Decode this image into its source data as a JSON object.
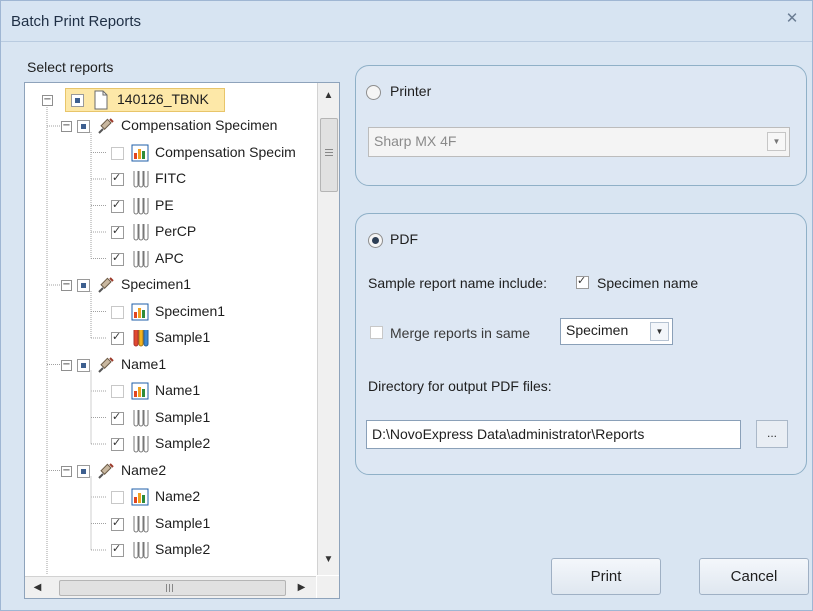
{
  "window": {
    "title": "Batch Print Reports",
    "close_glyph": "✕"
  },
  "select_reports_label": "Select reports",
  "tree": {
    "root": {
      "label": "140126_TBNK",
      "icon": "document-icon"
    },
    "nodes": [
      {
        "label": "Compensation Specimen",
        "icon": "syringe-icon",
        "type": "specimen",
        "state": "partial"
      },
      {
        "label": "Compensation Specim",
        "icon": "bar-chart-icon",
        "type": "report",
        "state": "unchecked"
      },
      {
        "label": "FITC",
        "icon": "tube-icon",
        "type": "sample",
        "state": "checked"
      },
      {
        "label": "PE",
        "icon": "tube-icon",
        "type": "sample",
        "state": "checked"
      },
      {
        "label": "PerCP",
        "icon": "tube-icon",
        "type": "sample",
        "state": "checked"
      },
      {
        "label": "APC",
        "icon": "tube-icon",
        "type": "sample",
        "state": "checked"
      },
      {
        "label": "Specimen1",
        "icon": "syringe-icon",
        "type": "specimen",
        "state": "partial"
      },
      {
        "label": "Specimen1",
        "icon": "bar-chart-icon",
        "type": "report",
        "state": "unchecked"
      },
      {
        "label": "Sample1",
        "icon": "tube-color-icon",
        "type": "sample",
        "state": "checked"
      },
      {
        "label": "Name1",
        "icon": "syringe-icon",
        "type": "specimen",
        "state": "partial"
      },
      {
        "label": "Name1",
        "icon": "bar-chart-icon",
        "type": "report",
        "state": "unchecked"
      },
      {
        "label": "Sample1",
        "icon": "tube-icon",
        "type": "sample",
        "state": "checked"
      },
      {
        "label": "Sample2",
        "icon": "tube-icon",
        "type": "sample",
        "state": "checked"
      },
      {
        "label": "Name2",
        "icon": "syringe-icon",
        "type": "specimen",
        "state": "partial"
      },
      {
        "label": "Name2",
        "icon": "bar-chart-icon",
        "type": "report",
        "state": "unchecked"
      },
      {
        "label": "Sample1",
        "icon": "tube-icon",
        "type": "sample",
        "state": "checked"
      },
      {
        "label": "Sample2",
        "icon": "tube-icon",
        "type": "sample",
        "state": "checked"
      }
    ]
  },
  "printer": {
    "label": "Printer",
    "selected": false,
    "printer_name": "Sharp MX 4F"
  },
  "pdf": {
    "label": "PDF",
    "selected": true,
    "name_include_label": "Sample report name include:",
    "specimen_name_label": "Specimen name",
    "specimen_name_checked": true,
    "merge_label": "Merge reports in same",
    "merge_checked": false,
    "merge_value": "Specimen",
    "directory_label": "Directory for output PDF files:",
    "directory_value": "D:\\NovoExpress Data\\administrator\\Reports",
    "browse_label": "..."
  },
  "buttons": {
    "print": "Print",
    "cancel": "Cancel"
  },
  "colors": {
    "accent_highlight": "#fde8a8",
    "panel_border": "#8fb0c7",
    "window_bg": "#d9e5f2"
  }
}
